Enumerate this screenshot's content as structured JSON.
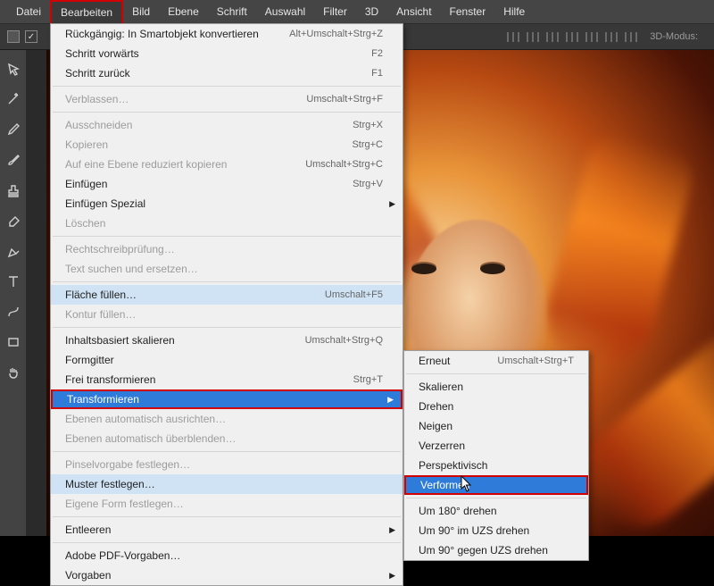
{
  "menubar": {
    "items": [
      "Datei",
      "Bearbeiten",
      "Bild",
      "Ebene",
      "Schrift",
      "Auswahl",
      "Filter",
      "3D",
      "Ansicht",
      "Fenster",
      "Hilfe"
    ],
    "active_index": 1
  },
  "toolbar": {
    "mode_label": "3D-Modus:"
  },
  "toolcol_icons": [
    "move",
    "wand",
    "eyedrop",
    "brush",
    "stamp",
    "eraser",
    "pen",
    "text",
    "path",
    "rect",
    "hand"
  ],
  "edit_menu": [
    {
      "label": "Rückgängig: In Smartobjekt konvertieren",
      "shortcut": "Alt+Umschalt+Strg+Z"
    },
    {
      "label": "Schritt vorwärts",
      "shortcut": "F2"
    },
    {
      "label": "Schritt zurück",
      "shortcut": "F1"
    },
    {
      "sep": true
    },
    {
      "label": "Verblassen…",
      "shortcut": "Umschalt+Strg+F",
      "disabled": true
    },
    {
      "sep": true
    },
    {
      "label": "Ausschneiden",
      "shortcut": "Strg+X",
      "disabled": true
    },
    {
      "label": "Kopieren",
      "shortcut": "Strg+C",
      "disabled": true
    },
    {
      "label": "Auf eine Ebene reduziert kopieren",
      "shortcut": "Umschalt+Strg+C",
      "disabled": true
    },
    {
      "label": "Einfügen",
      "shortcut": "Strg+V"
    },
    {
      "label": "Einfügen Spezial",
      "submenu": true
    },
    {
      "label": "Löschen",
      "disabled": true
    },
    {
      "sep": true
    },
    {
      "label": "Rechtschreibprüfung…",
      "disabled": true
    },
    {
      "label": "Text suchen und ersetzen…",
      "disabled": true
    },
    {
      "sep": true
    },
    {
      "label": "Fläche füllen…",
      "shortcut": "Umschalt+F5",
      "hover": true
    },
    {
      "label": "Kontur füllen…",
      "disabled": true
    },
    {
      "sep": true
    },
    {
      "label": "Inhaltsbasiert skalieren",
      "shortcut": "Umschalt+Strg+Q"
    },
    {
      "label": "Formgitter"
    },
    {
      "label": "Frei transformieren",
      "shortcut": "Strg+T"
    },
    {
      "label": "Transformieren",
      "submenu": true,
      "selected": true
    },
    {
      "label": "Ebenen automatisch ausrichten…",
      "disabled": true
    },
    {
      "label": "Ebenen automatisch überblenden…",
      "disabled": true
    },
    {
      "sep": true
    },
    {
      "label": "Pinselvorgabe festlegen…",
      "disabled": true
    },
    {
      "label": "Muster festlegen…",
      "hover": true
    },
    {
      "label": "Eigene Form festlegen…",
      "disabled": true
    },
    {
      "sep": true
    },
    {
      "label": "Entleeren",
      "submenu": true
    },
    {
      "sep": true
    },
    {
      "label": "Adobe PDF-Vorgaben…"
    },
    {
      "label": "Vorgaben",
      "submenu": true
    }
  ],
  "transform_submenu": [
    {
      "label": "Erneut",
      "shortcut": "Umschalt+Strg+T"
    },
    {
      "sep": true
    },
    {
      "label": "Skalieren"
    },
    {
      "label": "Drehen"
    },
    {
      "label": "Neigen"
    },
    {
      "label": "Verzerren"
    },
    {
      "label": "Perspektivisch"
    },
    {
      "label": "Verformen",
      "selected": true
    },
    {
      "sep": true
    },
    {
      "label": "Um 180° drehen"
    },
    {
      "label": "Um 90° im UZS drehen"
    },
    {
      "label": "Um 90° gegen UZS drehen"
    }
  ]
}
